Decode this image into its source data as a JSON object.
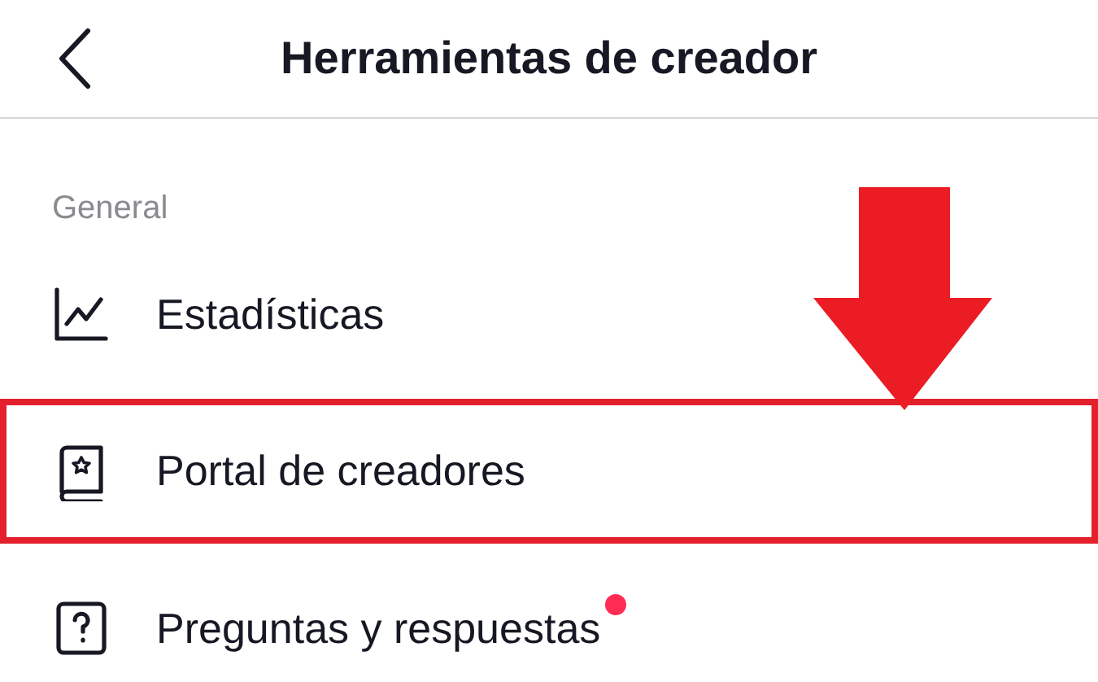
{
  "header": {
    "title": "Herramientas de creador"
  },
  "section": {
    "title": "General",
    "items": [
      {
        "kind": "stats",
        "label": "Estadísticas",
        "highlighted": false,
        "badge": false
      },
      {
        "kind": "portal",
        "label": "Portal de creadores",
        "highlighted": true,
        "badge": false
      },
      {
        "kind": "qa",
        "label": "Preguntas y respuestas",
        "highlighted": false,
        "badge": true
      }
    ]
  },
  "annotation": {
    "arrow": true
  }
}
